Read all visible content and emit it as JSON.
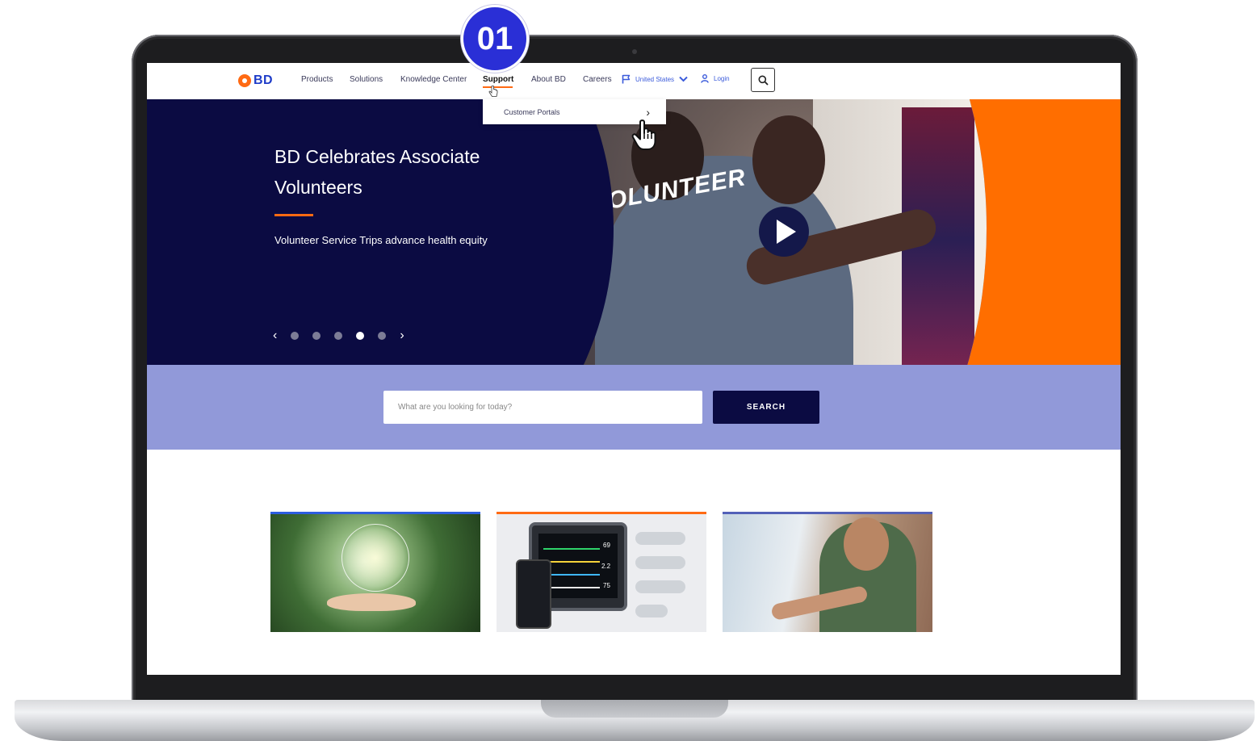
{
  "step_badge": "01",
  "header": {
    "logo_text": "BD",
    "nav": [
      "Products",
      "Solutions",
      "Knowledge Center",
      "Support",
      "About BD",
      "Careers"
    ],
    "active_nav": "Support",
    "country": "United States",
    "login": "Login",
    "icons": [
      "flag-icon",
      "chevron-down-icon",
      "user-icon",
      "search-icon"
    ]
  },
  "dropdown": {
    "item": "Customer Portals"
  },
  "hero": {
    "title": "BD Celebrates Associate Volunteers",
    "subtitle": "Volunteer Service Trips advance health equity",
    "shirt_text": "OLUNTEER",
    "carousel_total": 5,
    "carousel_active": 4
  },
  "search": {
    "placeholder": "What are you looking for today?",
    "button": "SEARCH"
  },
  "monitor_readouts": [
    "69",
    "2.2",
    "75"
  ],
  "colors": {
    "brand_blue": "#1e3cc8",
    "accent_orange": "#ff6a13",
    "navy": "#0b0b42",
    "band_lavender": "#9199d9",
    "badge_blue": "#2a2fd6"
  }
}
